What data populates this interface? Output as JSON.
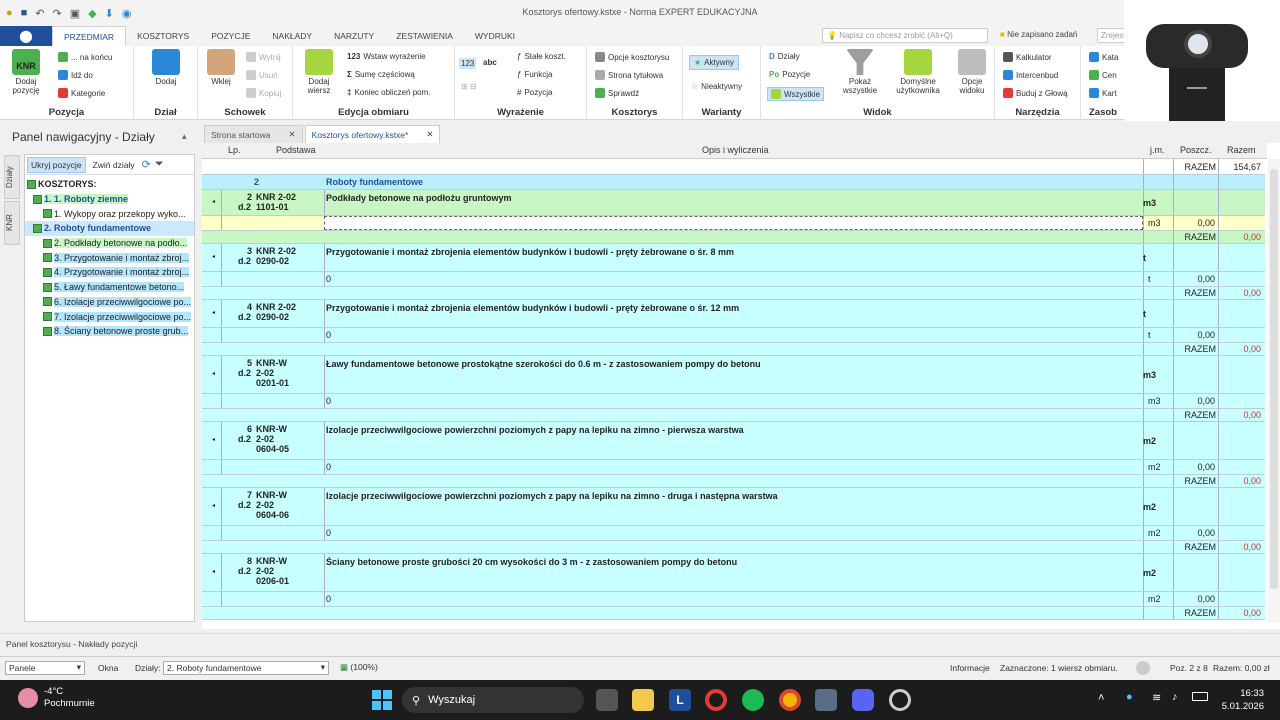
{
  "window": {
    "title": "Kosztorys ofertowy.kstxe - Norma EXPERT EDUKACYJNA"
  },
  "ribbon_tabs": [
    "PRZEDMIAR",
    "KOSZTORYS",
    "POZYCJE",
    "NAKŁADY",
    "NARZUTY",
    "ZESTAWIENIA",
    "WYDRUKI"
  ],
  "tellme": {
    "placeholder": "Napisz co chcesz zrobić (Alt+Q)"
  },
  "unsaved_label": "Nie zapisano zadań",
  "share_placeholder": "Zrejestruj",
  "ribbon": {
    "pozycja": {
      "name": "Pozycja",
      "dodaj": "Dodaj pozycję",
      "na_koncu": "... na końcu",
      "idz_do": "Idź do",
      "kategorie": "Kategorie"
    },
    "dzial": {
      "name": "Dział",
      "dodaj": "Dodaj"
    },
    "schowek": {
      "name": "Schowek",
      "wklej": "Wklej",
      "wytnij": "Wytnij",
      "usun": "Usuń",
      "kopiuj": "Kopiuj"
    },
    "edycja": {
      "name": "Edycja obmiaru",
      "dodaj_wiersz": "Dodaj wiersz",
      "wstaw": "Wstaw wyrażenie",
      "suma": "Sumę częściową",
      "koniec": "Koniec obliczeń pom."
    },
    "wyrazenie": {
      "name": "Wyrażenie",
      "stale": "Stałe koszt.",
      "funkcja": "Funkcja",
      "pozycja": "Pozycja",
      "b123": "123",
      "babc": "abc"
    },
    "kosztorys": {
      "name": "Kosztorys",
      "opcje": "Opcje kosztorysu",
      "strona": "Strona tytułowa",
      "sprawdz": "Sprawdź"
    },
    "warianty": {
      "name": "Warianty",
      "aktywny": "Aktywny",
      "nieaktywny": "Nieaktywny"
    },
    "widok": {
      "name": "Widok",
      "dzialy": "Działy",
      "pozycje": "Pozycje",
      "wszystkie": "Wszystkie",
      "pokaz": "Pokaż wszystkie",
      "domyslne": "Domyślne użytkownika",
      "opcje_widoku": "Opcje widoku"
    },
    "narzedzia": {
      "name": "Narzędzia",
      "kalkulator": "Kalkulator",
      "intercenbud": "Intercenbud",
      "buduj": "Buduj z Głową"
    },
    "zasoby": {
      "name": "Zasob",
      "kat": "Kata",
      "cen": "Cen",
      "kart": "Kart"
    }
  },
  "nav": {
    "title": "Panel nawigacyjny - Działy",
    "vtabs": [
      "Działy",
      "KNR"
    ],
    "tools": {
      "ukryj": "Ukryj pozycje",
      "zwin": "Zwiń działy"
    },
    "tree": [
      {
        "label": "KOSZTORYS:",
        "cls": "root"
      },
      {
        "label": "1. 1. Roboty ziemne",
        "cls": "lvl1 hl"
      },
      {
        "label": "1. Wykopy oraz przekopy wyko...",
        "cls": "lvl2"
      },
      {
        "label": "2. Roboty fundamentowe",
        "cls": "lvl1 sel"
      },
      {
        "label": "2. Podkłady betonowe na podło...",
        "cls": "lvl2 hl"
      },
      {
        "label": "3. Przygotowanie i montaż zbroj...",
        "cls": "lvl2 selb"
      },
      {
        "label": "4. Przygotowanie i montaż zbroj...",
        "cls": "lvl2 selb"
      },
      {
        "label": "5. Ławy fundamentowe betono...",
        "cls": "lvl2 selb"
      },
      {
        "label": "6. Izolacje przeciwwilgociowe po...",
        "cls": "lvl2 selb"
      },
      {
        "label": "7. Izolacje przeciwwilgociowe po...",
        "cls": "lvl2 selb"
      },
      {
        "label": "8. Ściany betonowe proste grub...",
        "cls": "lvl2 selb"
      }
    ]
  },
  "doc_tabs": [
    "Strona startowa",
    "Kosztorys ofertowy.kstxe*"
  ],
  "grid": {
    "headers": {
      "lp": "Lp.",
      "podstawa": "Podstawa",
      "opis": "Opis i wyliczenia",
      "jm": "j.m.",
      "poszcz": "Poszcz.",
      "razem": "Razem"
    },
    "top_razem": {
      "label": "RAZEM",
      "value": "154,67"
    },
    "section": {
      "num": "2",
      "title": "Roboty fundamentowe"
    },
    "positions": [
      {
        "lp": "2",
        "basis1": "KNR 2-02",
        "d": "d.2",
        "basis2": "1101-01",
        "basis3": "",
        "desc": "Podkłady betonowe na podłożu gruntowym",
        "unit": "m3",
        "calc": "",
        "qty": "0,00",
        "razem_label": "RAZEM",
        "razem": "0,00"
      },
      {
        "lp": "3",
        "basis1": "KNR 2-02",
        "d": "d.2",
        "basis2": "0290-02",
        "basis3": "",
        "desc": "Przygotowanie i montaż zbrojenia elementów budynków i budowli - pręty żebrowane o śr. 8 mm",
        "unit": "t",
        "calc": "0",
        "qty": "0,00",
        "razem_label": "RAZEM",
        "razem": "0,00"
      },
      {
        "lp": "4",
        "basis1": "KNR 2-02",
        "d": "d.2",
        "basis2": "0290-02",
        "basis3": "",
        "desc": "Przygotowanie i montaż zbrojenia elementów budynków i budowli - pręty żebrowane o śr. 12 mm",
        "unit": "t",
        "calc": "0",
        "qty": "0,00",
        "razem_label": "RAZEM",
        "razem": "0,00"
      },
      {
        "lp": "5",
        "basis1": "KNR-W",
        "d": "d.2",
        "basis2": "2-02",
        "basis3": "0201-01",
        "desc": "Ławy fundamentowe betonowe prostokątne szerokości do 0.6 m - z zastosowaniem pompy do betonu",
        "unit": "m3",
        "calc": "0",
        "qty": "0,00",
        "razem_label": "RAZEM",
        "razem": "0,00"
      },
      {
        "lp": "6",
        "basis1": "KNR-W",
        "d": "d.2",
        "basis2": "2-02",
        "basis3": "0604-05",
        "desc": "Izolacje przeciwwilgociowe powierzchni poziomych z papy na lepiku na zimno - pierwsza warstwa",
        "unit": "m2",
        "calc": "0",
        "qty": "0,00",
        "razem_label": "RAZEM",
        "razem": "0,00"
      },
      {
        "lp": "7",
        "basis1": "KNR-W",
        "d": "d.2",
        "basis2": "2-02",
        "basis3": "0604-06",
        "desc": "Izolacje przeciwwilgociowe powierzchni poziomych z papy na lepiku na zimno - druga i następna warstwa",
        "unit": "m2",
        "calc": "0",
        "qty": "0,00",
        "razem_label": "RAZEM",
        "razem": "0,00"
      },
      {
        "lp": "8",
        "basis1": "KNR-W",
        "d": "d.2",
        "basis2": "2-02",
        "basis3": "0206-01",
        "desc": "Ściany betonowe proste grubości 20 cm wysokości do 3 m - z zastosowaniem pompy do betonu",
        "unit": "m2",
        "calc": "0",
        "qty": "0,00",
        "razem_label": "RAZEM",
        "razem": "0,00"
      }
    ]
  },
  "statusbar": {
    "panel": "Panel kosztorysu - Nakłady pozycji"
  },
  "bottombar": {
    "panele": "Panele",
    "okna": "Okna",
    "dzialy_label": "Działy:",
    "dzialy_value": "2. Roboty fundamentowe",
    "zoom": "(100%)",
    "info": "Informacje",
    "zaznaczone": "Zaznaczone: 1 wiersz obmiaru.",
    "poz": "Poz. 2 z 8",
    "razem": "Razem: 0,00 zł"
  },
  "taskbar": {
    "temp": "-4°C",
    "weather": "Pochmurnie",
    "search": "Wyszukaj",
    "time": "16:33",
    "date": "5.01.2026",
    "lbadge": "L"
  },
  "colors": {
    "accent": "#1f4e9a",
    "row_cyan": "#c8ffff",
    "row_green": "#c8f7c5",
    "row_yellow": "#ffffc8",
    "section": "#b8f0ff"
  }
}
